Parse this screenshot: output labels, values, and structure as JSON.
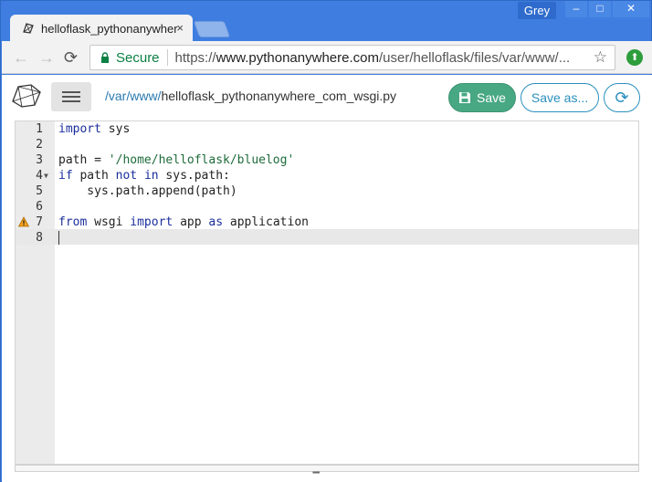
{
  "browser": {
    "tab_title": "helloflask_pythonanywhere",
    "tab_close": "×",
    "profile": "Grey",
    "controls": {
      "minimize": "–",
      "maximize": "□",
      "close": "✕"
    },
    "back": "←",
    "forward": "→",
    "reload": "⟳",
    "secure_label": "Secure",
    "url_scheme": "https://",
    "url_host": "www.pythonanywhere.com",
    "url_path": "/user/helloflask/files/var/www/...",
    "star": "☆",
    "ext_icon": "⬆"
  },
  "page": {
    "path_dir": "/var/www/",
    "path_file": "helloflask_pythonanywhere_com_wsgi.py",
    "save_label": "Save",
    "save_as_label": "Save as...",
    "refresh_icon": "⟳"
  },
  "editor": {
    "lines": [
      {
        "n": "1",
        "code": "import sys"
      },
      {
        "n": "2",
        "code": ""
      },
      {
        "n": "3",
        "code": "path = '/home/helloflask/bluelog'"
      },
      {
        "n": "4",
        "code": "if path not in sys.path:"
      },
      {
        "n": "5",
        "code": "    sys.path.append(path)"
      },
      {
        "n": "6",
        "code": ""
      },
      {
        "n": "7",
        "code": "from wsgi import app as application"
      },
      {
        "n": "8",
        "code": ""
      }
    ],
    "active_line": "8",
    "warning_line": "7"
  },
  "colors": {
    "chrome_blue": "#3f7ee0",
    "save_green": "#48a883",
    "accent_blue": "#2a8fbd",
    "keyword": "#1a2e9c",
    "string": "#1e6b3a"
  }
}
